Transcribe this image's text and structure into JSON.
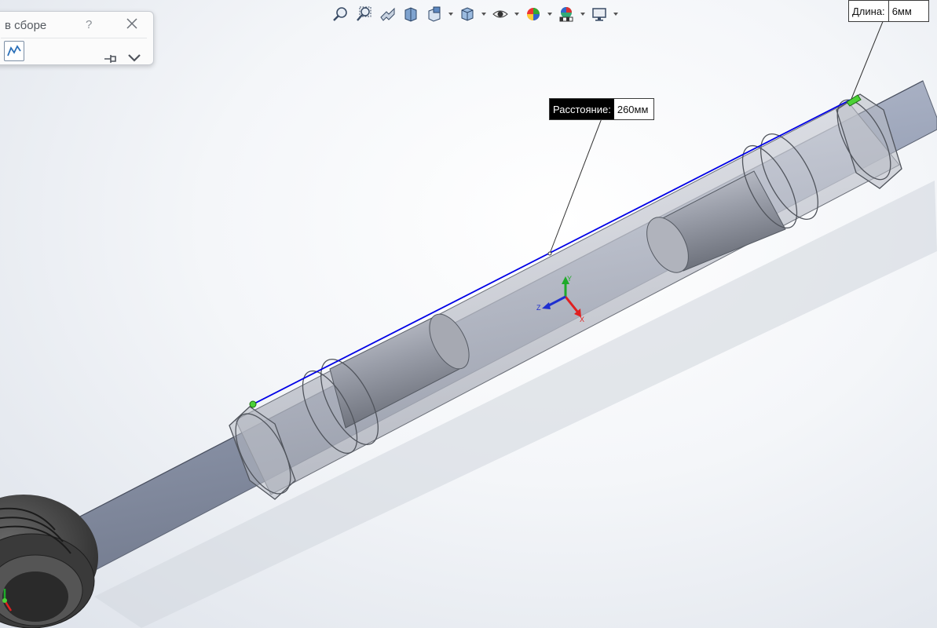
{
  "panel": {
    "title": "в сборе",
    "help_symbol": "?"
  },
  "toolbar": {
    "items": [
      {
        "icon": "zoom-to-fit-icon"
      },
      {
        "icon": "zoom-to-area-icon"
      },
      {
        "icon": "previous-view-icon"
      },
      {
        "icon": "section-view-icon"
      },
      {
        "icon": "view-orientation-icon"
      },
      {
        "icon": "display-style-icon"
      },
      {
        "icon": "hide-show-items-icon"
      },
      {
        "icon": "edit-appearance-icon"
      },
      {
        "icon": "apply-scene-icon"
      },
      {
        "icon": "view-settings-icon"
      }
    ]
  },
  "measurements": {
    "distance": {
      "label": "Расстояние:",
      "value": "260мм"
    },
    "length": {
      "label": "Длина:",
      "value": "6мм"
    }
  },
  "triad": {
    "x_label": "X",
    "y_label": "Y",
    "z_label": "Z"
  },
  "colors": {
    "shaft": "#aab3c6",
    "tube": "#c8cbd3",
    "measure_line": "#0000e6",
    "point": "#4cd137",
    "axis_x": "#e02020",
    "axis_y": "#1faa2a",
    "axis_z": "#1e2fd0"
  }
}
